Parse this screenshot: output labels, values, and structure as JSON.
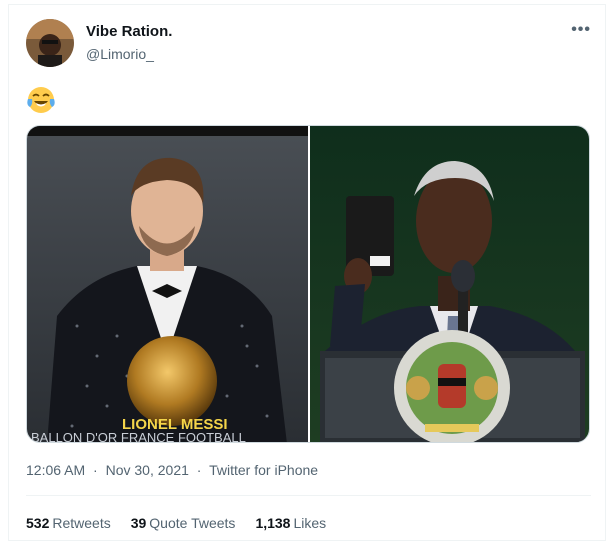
{
  "tweet": {
    "display_name": "Vibe Ration.",
    "handle": "@Limorio_",
    "more_label": "•••",
    "emoji_name": "face-with-tears-of-joy",
    "photo_left_caption_name": "LIONEL MESSI",
    "photo_left_caption_sub": "BALLON D'OR FRANCE FOOTBALL",
    "time": "12:06 AM",
    "dot1": "·",
    "date": "Nov 30, 2021",
    "dot2": "·",
    "source": "Twitter for iPhone"
  },
  "stats": {
    "retweets_count": "532",
    "retweets_label": "Retweets",
    "quotes_count": "39",
    "quotes_label": "Quote Tweets",
    "likes_count": "1,138",
    "likes_label": "Likes"
  },
  "colors": {
    "text_primary": "#0f1419",
    "text_secondary": "#536471",
    "border": "#eff3f4"
  }
}
